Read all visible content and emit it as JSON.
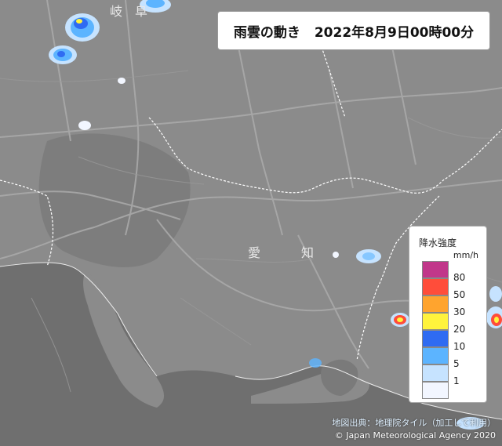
{
  "title": {
    "label": "雨雲の動き",
    "datetime": "2022年8月9日00時00分"
  },
  "legend": {
    "title": "降水強度",
    "unit": "mm/h",
    "levels": [
      {
        "label": "80",
        "color": "#c1378a"
      },
      {
        "label": "50",
        "color": "#ff4d3a"
      },
      {
        "label": "30",
        "color": "#ffa42e"
      },
      {
        "label": "20",
        "color": "#fff33c"
      },
      {
        "label": "10",
        "color": "#2f6bf2"
      },
      {
        "label": "5",
        "color": "#5cb4ff"
      },
      {
        "label": "1",
        "color": "#c6e3ff"
      },
      {
        "label": "",
        "color": "#f2f6ff"
      }
    ]
  },
  "map_labels": {
    "gifu": "岐　阜",
    "aichi_1": "愛",
    "aichi_2": "知"
  },
  "credits": {
    "source": "地図出典：地理院タイル（加工して利用）",
    "agency": "© Japan Meteorological Agency 2020"
  },
  "colors": {
    "land": "#8c8c8c",
    "sea": "#6f6f6f",
    "road": "#a8a8a8",
    "boundary": "#ffffff"
  }
}
